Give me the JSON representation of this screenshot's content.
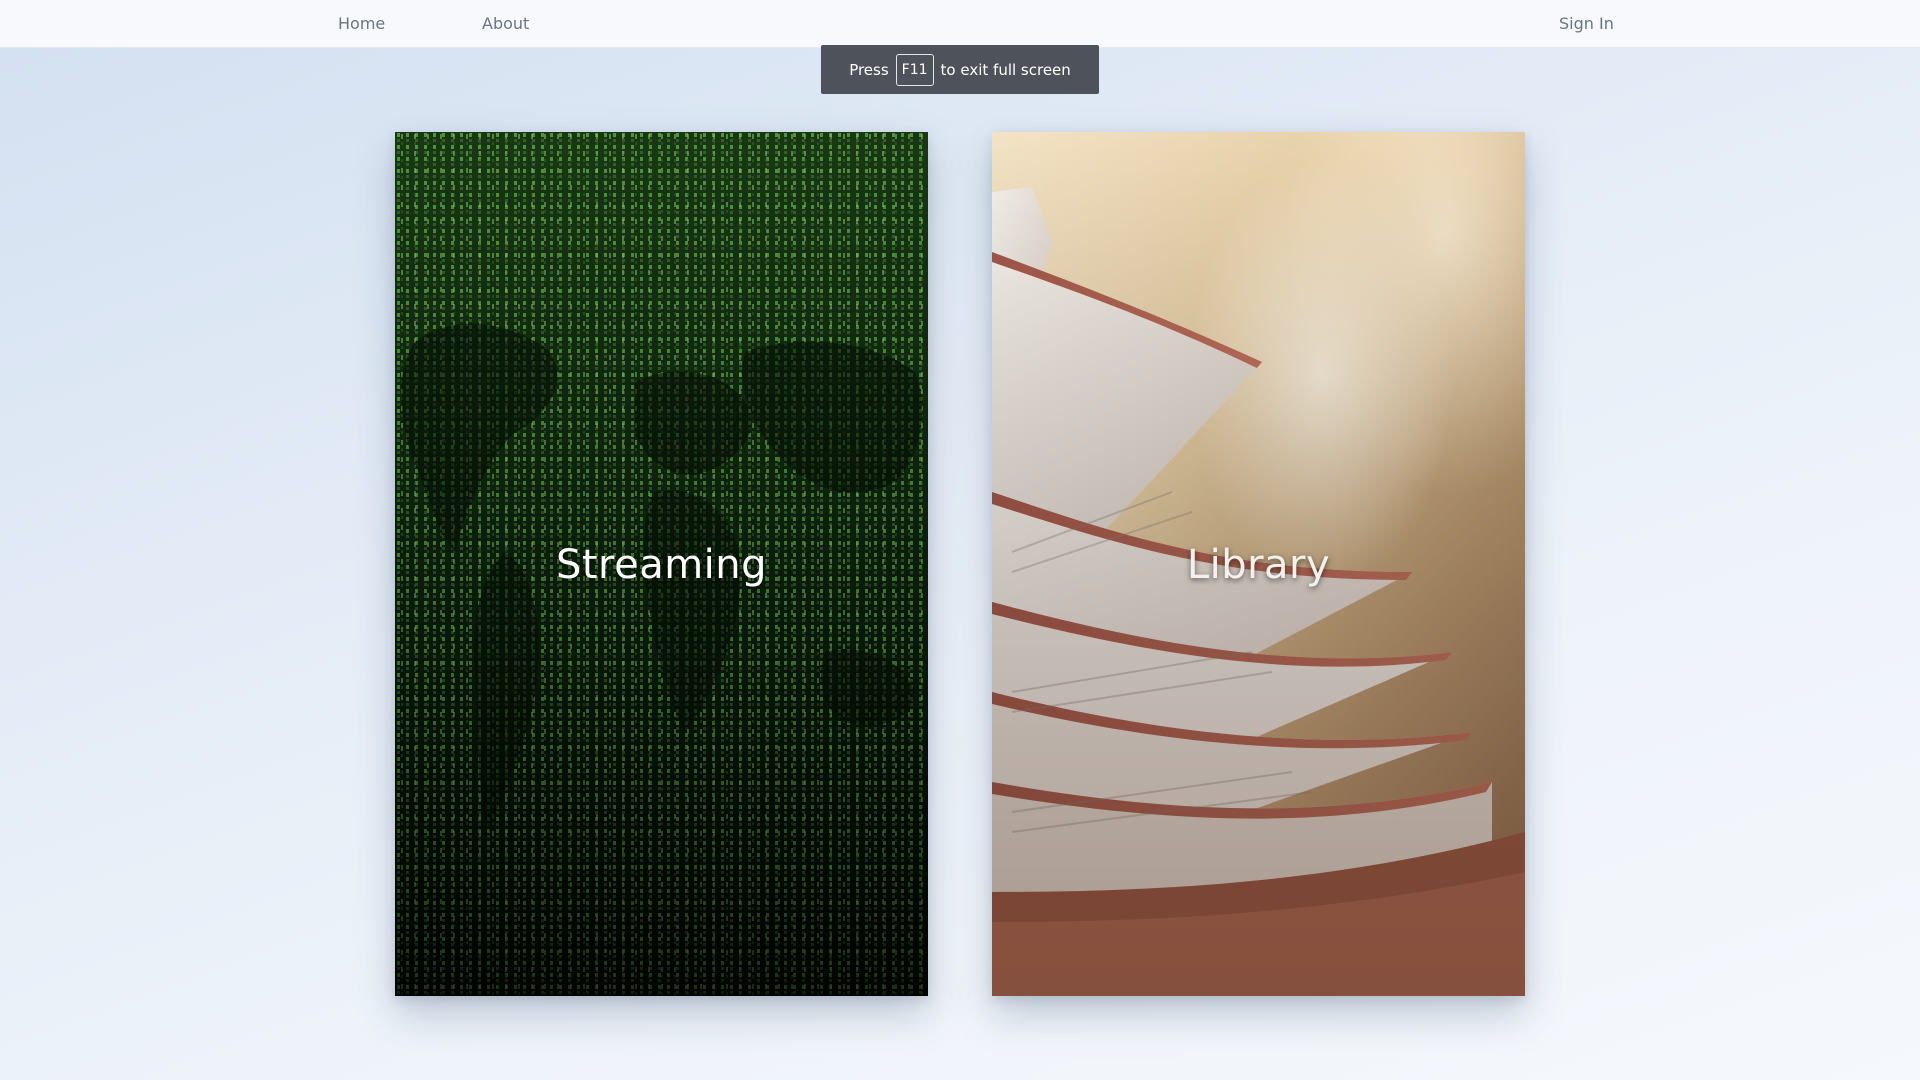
{
  "nav": {
    "home": "Home",
    "about": "About",
    "sign_in": "Sign In"
  },
  "fullscreen_toast": {
    "prefix": "Press",
    "key": "F11",
    "suffix": "to exit full screen"
  },
  "cards": [
    {
      "id": "streaming",
      "title": "Streaming",
      "image": "green-code-rain-world-map"
    },
    {
      "id": "library",
      "title": "Library",
      "image": "open-book-pages"
    }
  ],
  "colors": {
    "nav_bg": "#f7f9fc",
    "nav_text": "#6b7480",
    "toast_bg": "#4e535b",
    "matrix_green": "#4fa83d"
  }
}
